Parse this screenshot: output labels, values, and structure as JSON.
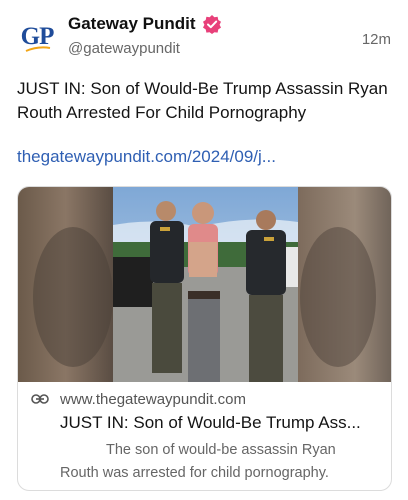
{
  "post": {
    "avatar_text": "GP",
    "display_name": "Gateway Pundit",
    "handle": "@gatewaypundit",
    "timestamp": "12m",
    "text": "JUST IN: Son of Would-Be Trump Assassin Ryan Routh Arrested For Child Pornography",
    "link_text": "thegatewaypundit.com/2024/09/j..."
  },
  "card": {
    "domain": "www.thegatewaypundit.com",
    "title": "JUST IN: Son of Would-Be Trump Ass...",
    "description": "The son of would-be assassin Ryan Routh was arrested for child pornography.",
    "image_icon": "photo-of-arrest",
    "link_icon": "link-icon"
  },
  "colors": {
    "brand_blue": "#1f4c9a",
    "verified_pink": "#e8407a",
    "link_blue": "#2f5fb3",
    "muted_gray": "#676767"
  }
}
